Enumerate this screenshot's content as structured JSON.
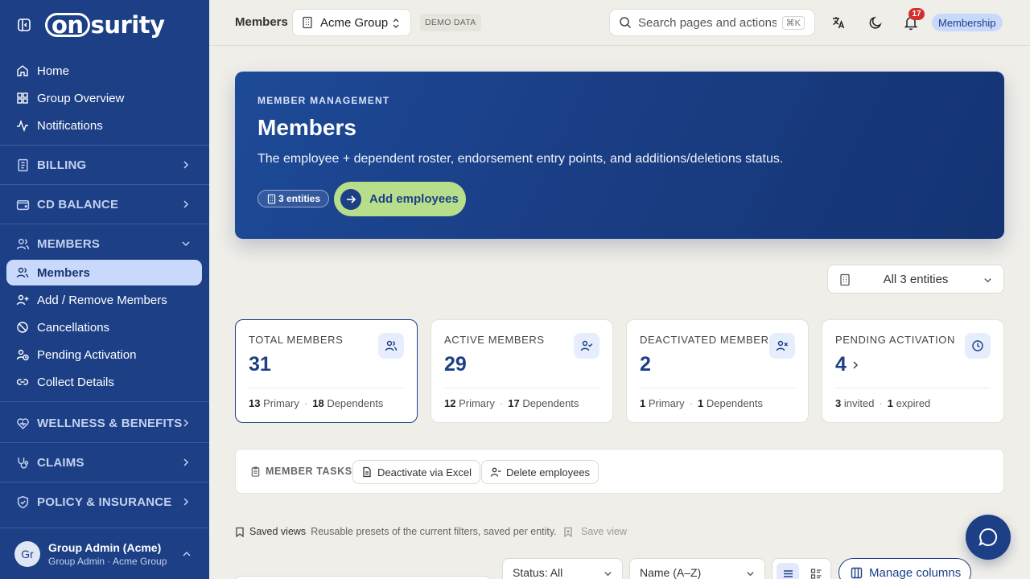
{
  "brand": {
    "logo_on": "on",
    "logo_rest": "surity"
  },
  "sidebar": {
    "home": "Home",
    "group_overview": "Group Overview",
    "notifications": "Notifications",
    "billing": "BILLING",
    "cd_balance": "CD BALANCE",
    "members_section": "MEMBERS",
    "members": "Members",
    "add_remove": "Add / Remove Members",
    "cancellations": "Cancellations",
    "pending_activation": "Pending Activation",
    "collect_details": "Collect Details",
    "wellness": "WELLNESS & BENEFITS",
    "claims": "CLAIMS",
    "policy": "POLICY & INSURANCE",
    "user": {
      "initials": "Gr",
      "name": "Group Admin (Acme)",
      "role": "Group Admin · Acme Group"
    }
  },
  "topbar": {
    "title": "Members",
    "group": "Acme Group",
    "demo_badge": "DEMO DATA",
    "search_placeholder": "Search pages and actions...",
    "search_shortcut": "⌘K",
    "notif_count": "17",
    "membership": "Membership"
  },
  "hero": {
    "eyebrow": "MEMBER MANAGEMENT",
    "title": "Members",
    "description": "The employee + dependent roster, endorsement entry points, and additions/deletions status.",
    "entities_badge": "3 entities",
    "cta": "Add employees"
  },
  "entity_select": {
    "value": "All 3 entities"
  },
  "stats": [
    {
      "label": "TOTAL MEMBERS",
      "value": "31",
      "a_num": "13",
      "a_lbl": "Primary",
      "b_num": "18",
      "b_lbl": "Dependents"
    },
    {
      "label": "ACTIVE MEMBERS",
      "value": "29",
      "a_num": "12",
      "a_lbl": "Primary",
      "b_num": "17",
      "b_lbl": "Dependents"
    },
    {
      "label": "DEACTIVATED MEMBERS",
      "value": "2",
      "a_num": "1",
      "a_lbl": "Primary",
      "b_num": "1",
      "b_lbl": "Dependents"
    },
    {
      "label": "PENDING ACTIVATION",
      "value": "4",
      "a_num": "3",
      "a_lbl": "invited",
      "b_num": "1",
      "b_lbl": "expired"
    }
  ],
  "tasks": {
    "label": "MEMBER TASKS",
    "deactivate": "Deactivate via Excel",
    "delete": "Delete employees"
  },
  "saved_views": {
    "label": "Saved views",
    "hint": "Reusable presets of the current filters, saved per entity.",
    "save": "Save view"
  },
  "filters": {
    "status": "Status: All",
    "sort": "Name (A–Z)",
    "manage_columns": "Manage columns"
  },
  "colors": {
    "sidebar": "#1c3f86",
    "active_item": "#c9d9fb",
    "cta": "#b7df8b",
    "badge": "#d32f2f"
  }
}
